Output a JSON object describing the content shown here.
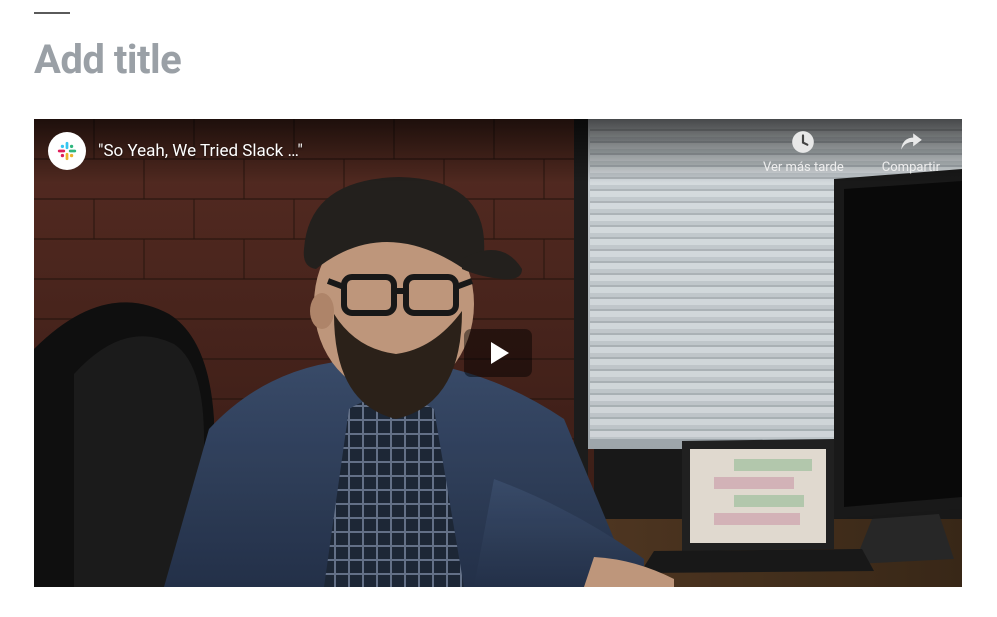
{
  "page": {
    "title_placeholder": "Add title"
  },
  "video": {
    "title": "\"So Yeah, We Tried Slack …\"",
    "channel_icon_alt": "Slack",
    "play_label": "Play",
    "actions": {
      "watch_later": "Ver más tarde",
      "share": "Compartir"
    }
  }
}
